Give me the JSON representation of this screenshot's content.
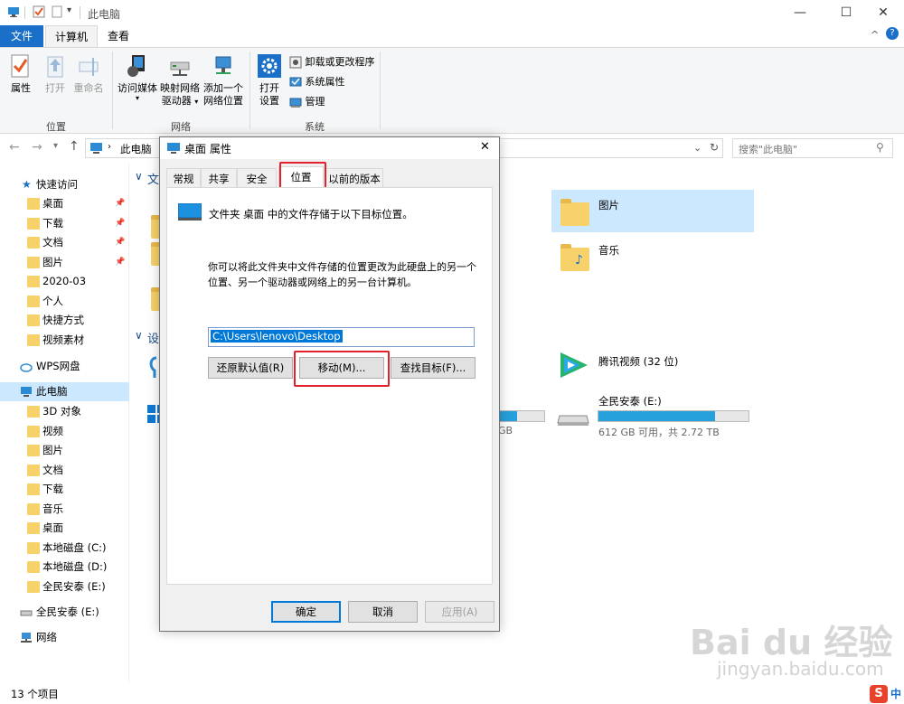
{
  "window": {
    "title": "此电脑",
    "controls": {
      "minimize": "—",
      "maximize": "☐",
      "close": "✕"
    }
  },
  "ribbon": {
    "tabs": [
      {
        "label": "文件"
      },
      {
        "label": "计算机"
      },
      {
        "label": "查看"
      }
    ],
    "groups": {
      "location": {
        "label": "位置",
        "buttons": [
          {
            "label": "属性"
          },
          {
            "label": "打开"
          },
          {
            "label": "重命名"
          }
        ]
      },
      "network": {
        "label": "网络",
        "buttons": [
          {
            "label": "访问媒体",
            "has_dropdown": true
          },
          {
            "line1": "映射网络",
            "line2": "驱动器"
          },
          {
            "line1": "添加一个",
            "line2": "网络位置"
          }
        ]
      },
      "system": {
        "label": "系统",
        "open": {
          "line1": "打开",
          "line2": "设置"
        },
        "items": [
          {
            "label": "卸载或更改程序"
          },
          {
            "label": "系统属性"
          },
          {
            "label": "管理"
          }
        ]
      }
    },
    "collapse_glyph": "^",
    "help_glyph": "?"
  },
  "address": {
    "path_label": "此电脑",
    "search_placeholder": "搜索\"此电脑\""
  },
  "nav": {
    "quick_access": "快速访问",
    "quick_items": [
      {
        "label": "桌面",
        "pinned": true
      },
      {
        "label": "下载",
        "pinned": true
      },
      {
        "label": "文档",
        "pinned": true
      },
      {
        "label": "图片",
        "pinned": true
      },
      {
        "label": "2020-03"
      },
      {
        "label": "个人"
      },
      {
        "label": "快捷方式"
      },
      {
        "label": "视频素材"
      }
    ],
    "wps": "WPS网盘",
    "this_pc": "此电脑",
    "pc_items": [
      {
        "label": "3D 对象"
      },
      {
        "label": "视频"
      },
      {
        "label": "图片"
      },
      {
        "label": "文档"
      },
      {
        "label": "下载"
      },
      {
        "label": "音乐"
      },
      {
        "label": "桌面"
      },
      {
        "label": "本地磁盘 (C:)"
      },
      {
        "label": "本地磁盘 (D:)"
      },
      {
        "label": "全民安泰 (E:)"
      }
    ],
    "drive_e": "全民安泰 (E:)",
    "network": "网络"
  },
  "main": {
    "section_folders_partial": "文",
    "section_devices_partial": "设",
    "folders": [
      {
        "label": "图片"
      },
      {
        "label": "音乐"
      }
    ],
    "apps": [
      {
        "label": "腾讯视频 (32 位)"
      }
    ],
    "drives": [
      {
        "label": "全民安泰 (E:)",
        "info": "612 GB 可用，共 2.72 TB",
        "used_fraction": 0.78
      },
      {
        "label": "",
        "info_partial": "GB",
        "used_fraction": 0.55
      }
    ]
  },
  "status": {
    "count": "13 个项目"
  },
  "dialog": {
    "title": "桌面 属性",
    "close": "✕",
    "tabs": [
      {
        "label": "常规"
      },
      {
        "label": "共享"
      },
      {
        "label": "安全"
      },
      {
        "label": "位置",
        "active": true
      },
      {
        "label": "以前的版本"
      }
    ],
    "header_text": "文件夹 桌面 中的文件存储于以下目标位置。",
    "desc_line1": "你可以将此文件夹中文件存储的位置更改为此硬盘上的另一个",
    "desc_line2": "位置、另一个驱动器或网络上的另一台计算机。",
    "path_value": "C:\\Users\\lenovo\\Desktop",
    "buttons": {
      "restore": "还原默认值(R)",
      "move": "移动(M)...",
      "find": "查找目标(F)..."
    },
    "footer": {
      "ok": "确定",
      "cancel": "取消",
      "apply": "应用(A)"
    }
  },
  "watermark": {
    "logo": "Bai du 经验",
    "url": "jingyan.baidu.com"
  },
  "ime": {
    "label": "中"
  },
  "colors": {
    "accent": "#1a6fc9",
    "highlight_red": "#e3202b",
    "selection": "#cce8ff"
  }
}
